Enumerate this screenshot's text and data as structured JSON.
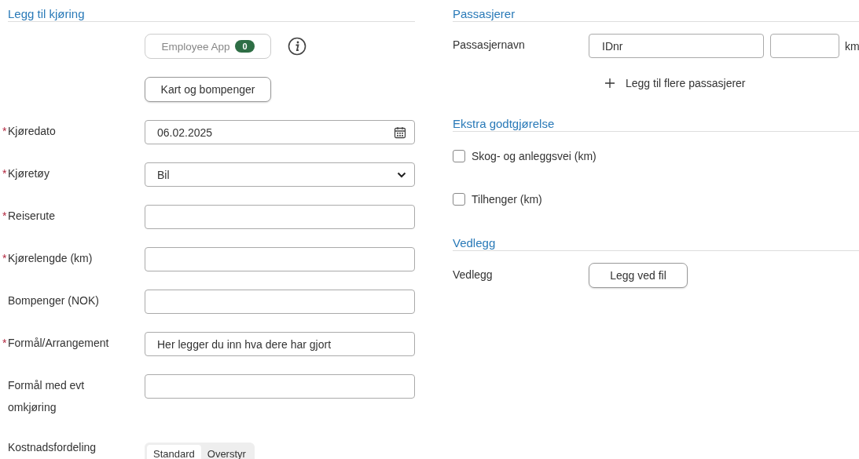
{
  "trip": {
    "title": "Legg til kjøring",
    "required_mark": "*",
    "employee_app": {
      "label": "Employee App",
      "count": "0"
    },
    "map_button": "Kart og bompenger",
    "fields": [
      {
        "kind": "date",
        "label": "Kjøredato",
        "required": true,
        "value": "06.02.2025"
      },
      {
        "kind": "select",
        "label": "Kjøretøy",
        "required": true,
        "value": "Bil"
      },
      {
        "kind": "text",
        "label": "Reiserute",
        "required": true
      },
      {
        "kind": "text",
        "label": "Kjørelengde (km)",
        "required": true
      },
      {
        "kind": "text",
        "label": "Bompenger (NOK)",
        "required": false
      },
      {
        "kind": "text",
        "label": "Formål/Arrangement",
        "required": true,
        "value": "Her legger du inn hva dere har gjort"
      },
      {
        "kind": "text",
        "label": "Formål med evt omkjøring",
        "required": false
      },
      {
        "kind": "segmented",
        "label": "Kostnadsfordeling",
        "required": false,
        "options": [
          {
            "label": "Standard",
            "selected": true
          },
          {
            "label": "Overstyr",
            "selected": false
          }
        ]
      }
    ]
  },
  "passengers": {
    "title": "Passasjerer",
    "label": "Passasjernavn",
    "id_value": "IDnr",
    "km_unit": "km",
    "add_link": "Legg til flere passasjerer"
  },
  "extra": {
    "title": "Ekstra godtgjørelse",
    "options": [
      {
        "label": "Skog- og anleggsvei (km)",
        "checked": false
      },
      {
        "label": "Tilhenger (km)",
        "checked": false
      }
    ]
  },
  "attachments": {
    "title": "Vedlegg",
    "label": "Vedlegg",
    "button": "Legg ved fil"
  }
}
